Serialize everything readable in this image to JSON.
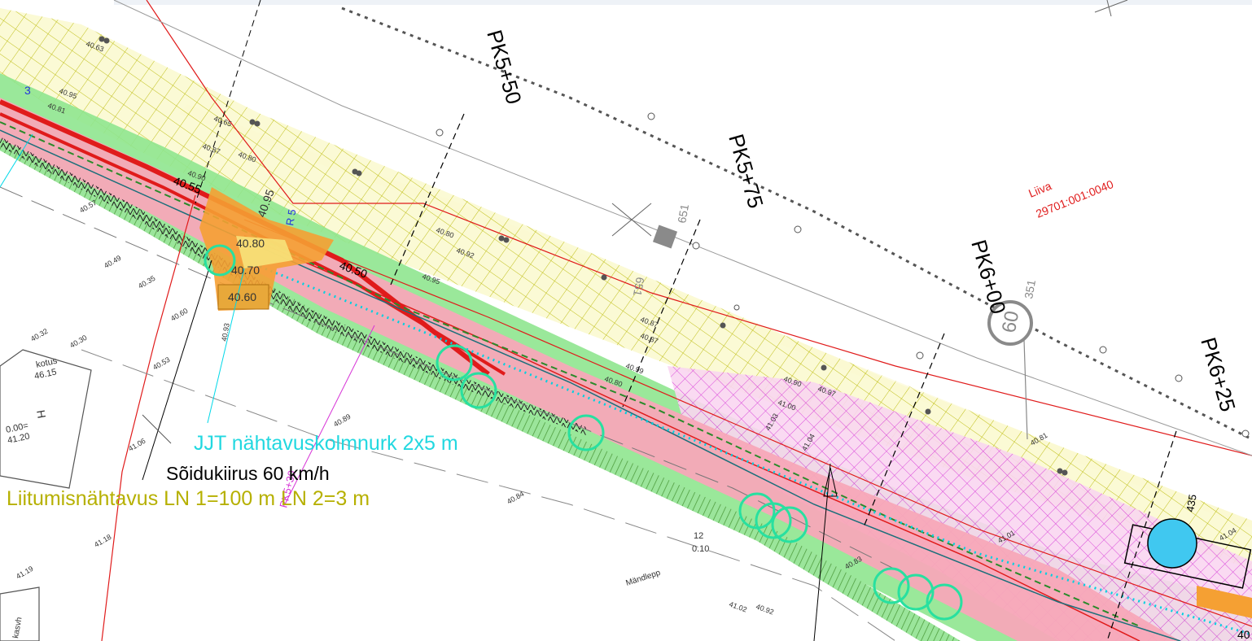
{
  "colors": {
    "road_red": "#e01b1b",
    "green_shoulder": "#8fe68f",
    "pink_lane": "#f7a8b8",
    "yellow_hatch": "#c8c800",
    "magenta": "#d633d6",
    "cyan": "#00e0e0",
    "orange": "#f5a033",
    "boundary_red": "#e01b1b"
  },
  "stations": [
    "PK5+50",
    "PK5+75",
    "PK6+00",
    "PK6+25"
  ],
  "parcel": {
    "name": "Liiva",
    "code": "29701:001:0040"
  },
  "speed_sign": "60",
  "legend": {
    "visibility_triangle": "JJT nähtavuskolmnurk 2x5 m",
    "speed": "Sõidukiirus 60 km/h",
    "junction_visibility": "Liitumisnähtavus LN 1=100 m LN 2=3 m"
  },
  "labels": {
    "kotus": "kotus",
    "kotus_value": "46.15",
    "h": "H",
    "zero": "0.00=",
    "zero_value": "41.20",
    "kasvh": "kasvh",
    "mandlepp": "Mändlepp",
    "tree_count": "12",
    "tree_size": "0.10",
    "r5": "R 5",
    "pk_vertical": "PK5+30",
    "num_651a": "651",
    "num_651b": "651",
    "num_351": "351",
    "num_435": "435",
    "num_40": "40",
    "num_3": "3"
  },
  "elevations": [
    {
      "id": "e1",
      "v": "40.55"
    },
    {
      "id": "e2",
      "v": "40.50"
    },
    {
      "id": "e3",
      "v": "40.95"
    },
    {
      "id": "e4",
      "v": "40.80"
    },
    {
      "id": "e5",
      "v": "40.70"
    },
    {
      "id": "e6",
      "v": "40.60"
    },
    {
      "id": "e7",
      "v": "40.90"
    },
    {
      "id": "e8",
      "v": "40.63"
    },
    {
      "id": "e9",
      "v": "40.95"
    },
    {
      "id": "e10",
      "v": "40.81"
    },
    {
      "id": "e11",
      "v": "40.65"
    },
    {
      "id": "e12",
      "v": "40.87"
    },
    {
      "id": "e13",
      "v": "40.80"
    },
    {
      "id": "e14",
      "v": "40.57"
    },
    {
      "id": "e15",
      "v": "40.49"
    },
    {
      "id": "e16",
      "v": "40.35"
    },
    {
      "id": "e17",
      "v": "40.32"
    },
    {
      "id": "e18",
      "v": "40.30"
    },
    {
      "id": "e19",
      "v": "40.53"
    },
    {
      "id": "e20",
      "v": "40.60"
    },
    {
      "id": "e21",
      "v": "40.89"
    },
    {
      "id": "e22",
      "v": "41.06"
    },
    {
      "id": "e23",
      "v": "40.84"
    },
    {
      "id": "e24",
      "v": "41.18"
    },
    {
      "id": "e25",
      "v": "41.19"
    },
    {
      "id": "e26",
      "v": "40.80"
    },
    {
      "id": "e27",
      "v": "40.92"
    },
    {
      "id": "e28",
      "v": "40.95"
    },
    {
      "id": "e29",
      "v": "40.87"
    },
    {
      "id": "e30",
      "v": "40.87"
    },
    {
      "id": "e31",
      "v": "40.99"
    },
    {
      "id": "e32",
      "v": "40.90"
    },
    {
      "id": "e33",
      "v": "40.97"
    },
    {
      "id": "e34",
      "v": "41.00"
    },
    {
      "id": "e35",
      "v": "41.03"
    },
    {
      "id": "e36",
      "v": "41.04"
    },
    {
      "id": "e37",
      "v": "40.81"
    },
    {
      "id": "e38",
      "v": "41.02"
    },
    {
      "id": "e39",
      "v": "40.92"
    },
    {
      "id": "e40",
      "v": "40.83"
    },
    {
      "id": "e41",
      "v": "41.01"
    },
    {
      "id": "e42",
      "v": "41.04"
    },
    {
      "id": "e43",
      "v": "40.80"
    },
    {
      "id": "e44",
      "v": "40.93"
    }
  ]
}
